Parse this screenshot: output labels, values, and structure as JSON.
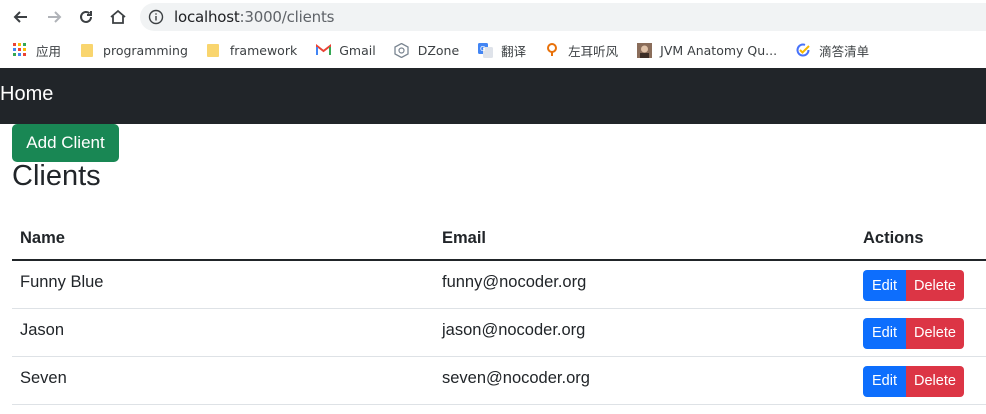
{
  "browser": {
    "url_host": "localhost",
    "url_path": ":3000/clients",
    "bookmarks": [
      {
        "label": "应用",
        "icon": "apps-grid-icon"
      },
      {
        "label": "programming",
        "icon": "folder-icon"
      },
      {
        "label": "framework",
        "icon": "folder-icon"
      },
      {
        "label": "Gmail",
        "icon": "gmail-icon"
      },
      {
        "label": "DZone",
        "icon": "dzone-icon"
      },
      {
        "label": "翻译",
        "icon": "translate-icon"
      },
      {
        "label": "左耳听风",
        "icon": "podcast-icon"
      },
      {
        "label": "JVM Anatomy Qu...",
        "icon": "avatar-icon"
      },
      {
        "label": "滴答清单",
        "icon": "checklist-icon"
      }
    ]
  },
  "navbar": {
    "brand": "Home"
  },
  "main": {
    "add_button": "Add Client",
    "title": "Clients",
    "table": {
      "headers": [
        "Name",
        "Email",
        "Actions"
      ],
      "rows": [
        {
          "name": "Funny Blue",
          "email": "funny@nocoder.org",
          "edit": "Edit",
          "delete": "Delete"
        },
        {
          "name": "Jason",
          "email": "jason@nocoder.org",
          "edit": "Edit",
          "delete": "Delete"
        },
        {
          "name": "Seven",
          "email": "seven@nocoder.org",
          "edit": "Edit",
          "delete": "Delete"
        }
      ]
    }
  },
  "colors": {
    "navbar": "#212529",
    "success": "#198754",
    "primary": "#0d6efd",
    "danger": "#dc3545"
  }
}
